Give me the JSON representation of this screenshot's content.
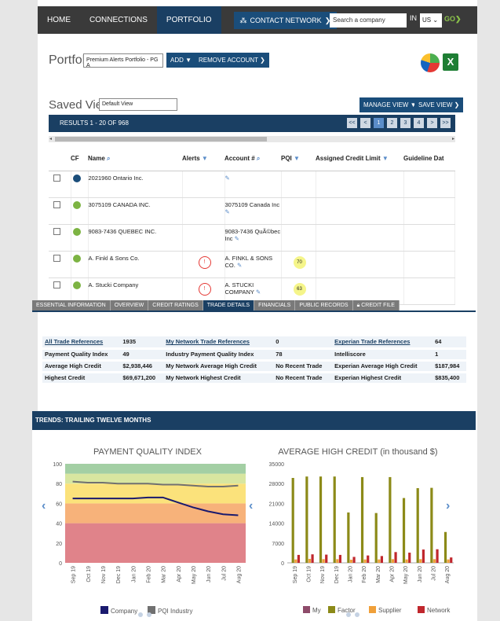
{
  "nav": {
    "items": [
      "HOME",
      "CONNECTIONS",
      "PORTFOLIO"
    ],
    "contact_network": "CONTACT NETWORK",
    "search_placeholder": "Search a company",
    "in_label": "IN",
    "country": "US",
    "go": "GO"
  },
  "portfolios": {
    "title": "Portfolios",
    "selected": "Premium Alerts Portfolio - PG A",
    "add": "ADD ▼",
    "remove": "REMOVE ACCOUNT"
  },
  "saved_views": {
    "title": "Saved Views",
    "selected": "Default View",
    "manage": "MANAGE VIEW ▼",
    "save": "SAVE VIEW"
  },
  "results": {
    "label": "RESULTS 1 - 20 OF 968",
    "pages": [
      "<<",
      "<",
      "1",
      "2",
      "3",
      "4",
      ">",
      ">>"
    ]
  },
  "columns": [
    "",
    "CF",
    "Name",
    "Alerts",
    "Account #",
    "PQI",
    "Assigned Credit Limit",
    "Guideline Dat"
  ],
  "rows": [
    {
      "name": "2021960 Ontario Inc.",
      "cf": "lock",
      "account": "",
      "alert": "",
      "pqi": ""
    },
    {
      "name": "3075109 CANADA INC.",
      "cf": "green",
      "account": "3075109 Canada Inc",
      "alert": "",
      "pqi": ""
    },
    {
      "name": "9083-7436 QUEBEC INC.",
      "cf": "green",
      "account": "9083-7436 QuÃ©bec Inc",
      "alert": "",
      "pqi": ""
    },
    {
      "name": "A. Finkl & Sons Co.",
      "cf": "green",
      "account": "A. FINKL & SONS CO.",
      "alert": "!",
      "pqi": "70"
    },
    {
      "name": "A. Stucki Company",
      "cf": "green",
      "account": "A. STUCKI COMPANY",
      "alert": "!",
      "pqi": "63"
    }
  ],
  "tabs": [
    "ESSENTIAL INFORMATION",
    "OVERVIEW",
    "CREDIT RATINGS",
    "TRADE DETAILS",
    "FINANCIALS",
    "PUBLIC RECORDS",
    "CREDIT FILE"
  ],
  "active_tab": "TRADE DETAILS",
  "trade": [
    [
      "All Trade References",
      "1935",
      "My Network Trade References",
      "0",
      "Experian Trade References",
      "64"
    ],
    [
      "Payment Quality Index",
      "49",
      "Industry Payment Quality Index",
      "78",
      "Intelliscore",
      "1"
    ],
    [
      "Average High Credit",
      "$2,938,446",
      "My Network Average High Credit",
      "No Recent Trade",
      "Experian Average High Credit",
      "$187,984"
    ],
    [
      "Highest Credit",
      "$69,671,200",
      "My Network Highest Credit",
      "No Recent Trade",
      "Experian Highest Credit",
      "$835,400"
    ]
  ],
  "trends_title": "TRENDS: TRAILING TWELVE MONTHS",
  "chart_data": [
    {
      "type": "line",
      "title": "PAYMENT QUALITY INDEX",
      "x": [
        "Sep 19",
        "Oct 19",
        "Nov 19",
        "Dec 19",
        "Jan 20",
        "Feb 20",
        "Mar 20",
        "Apr 20",
        "May 20",
        "Jun 20",
        "Jul 20",
        "Aug 20"
      ],
      "ylim": [
        0,
        100
      ],
      "yticks": [
        0,
        20,
        40,
        60,
        80,
        100
      ],
      "bands": [
        {
          "from": 0,
          "to": 40,
          "color": "#e0838a"
        },
        {
          "from": 40,
          "to": 60,
          "color": "#f7b27a"
        },
        {
          "from": 60,
          "to": 80,
          "color": "#fbe27b"
        },
        {
          "from": 80,
          "to": 90,
          "color": "#d8e6a0"
        },
        {
          "from": 90,
          "to": 100,
          "color": "#a3cfa4"
        }
      ],
      "series": [
        {
          "name": "Company",
          "color": "#1a1a6e",
          "values": [
            65,
            65,
            65,
            65,
            65,
            66,
            66,
            61,
            56,
            52,
            49,
            48
          ]
        },
        {
          "name": "PQI Industry",
          "color": "#707070",
          "values": [
            82,
            81,
            81,
            80,
            80,
            80,
            79,
            79,
            78,
            77,
            77,
            78
          ]
        }
      ],
      "legend": "bottom"
    },
    {
      "type": "bar",
      "title": "AVERAGE HIGH CREDIT (in thousand $)",
      "x": [
        "Sep 19",
        "Oct 19",
        "Nov 19",
        "Dec 19",
        "Jan 20",
        "Feb 20",
        "Mar 20",
        "Apr 20",
        "May 20",
        "Jun 20",
        "Jul 20",
        "Aug 20"
      ],
      "ylim": [
        0,
        35000
      ],
      "yticks": [
        0,
        7000,
        14000,
        21000,
        28000,
        35000
      ],
      "series": [
        {
          "name": "My",
          "color": "#8e4b6a",
          "values": [
            0,
            0,
            0,
            0,
            0,
            0,
            0,
            0,
            0,
            0,
            0,
            0
          ]
        },
        {
          "name": "Factor",
          "color": "#8c8a18",
          "values": [
            30000,
            30500,
            30500,
            30500,
            17800,
            30300,
            17600,
            30300,
            22900,
            26400,
            26500,
            10900
          ]
        },
        {
          "name": "Supplier",
          "color": "#f0a03a",
          "values": [
            1200,
            1400,
            1300,
            1300,
            1100,
            1200,
            1200,
            1300,
            1200,
            1300,
            1300,
            1200
          ]
        },
        {
          "name": "Network",
          "color": "#c0272d",
          "values": [
            2800,
            3000,
            2900,
            2800,
            2100,
            2600,
            2400,
            3800,
            3600,
            4700,
            4800,
            1900
          ]
        }
      ],
      "legend": "bottom"
    }
  ]
}
